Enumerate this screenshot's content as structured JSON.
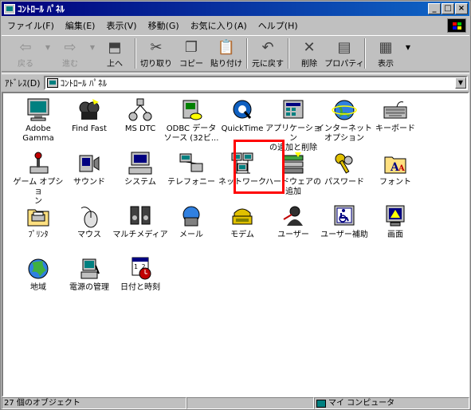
{
  "window": {
    "title": "ｺﾝﾄﾛｰﾙ ﾊﾟﾈﾙ",
    "buttons": {
      "minimize": "_",
      "maximize": "□",
      "close": "×"
    }
  },
  "menu": [
    "ファイル(F)",
    "編集(E)",
    "表示(V)",
    "移動(G)",
    "お気に入り(A)",
    "ヘルプ(H)"
  ],
  "toolbar": {
    "back": "戻る",
    "forward": "進む",
    "up": "上へ",
    "cut": "切り取り",
    "copy": "コピー",
    "paste": "貼り付け",
    "undo": "元に戻す",
    "delete": "削除",
    "properties": "プロパティ",
    "view": "表示"
  },
  "address": {
    "label": "ｱﾄﾞﾚｽ(D)",
    "value": "ｺﾝﾄﾛｰﾙ ﾊﾟﾈﾙ"
  },
  "icons": [
    {
      "label": "Adobe\nGamma",
      "icon": "monitor-icon"
    },
    {
      "label": "Find Fast",
      "icon": "find-fast-icon"
    },
    {
      "label": "MS DTC",
      "icon": "network-nodes-icon"
    },
    {
      "label": "ODBC データ\nソース (32ビ...",
      "icon": "odbc-icon"
    },
    {
      "label": "QuickTime",
      "icon": "quicktime-icon"
    },
    {
      "label": "アプリケーション\nの追加と削除",
      "icon": "add-remove-icon"
    },
    {
      "label": "インターネット\nオプション",
      "icon": "globe-icon"
    },
    {
      "label": "キーボード",
      "icon": "keyboard-icon"
    },
    {
      "label": "ゲーム オプショ\nン",
      "icon": "joystick-icon"
    },
    {
      "label": "サウンド",
      "icon": "speaker-icon"
    },
    {
      "label": "システム",
      "icon": "computer-icon"
    },
    {
      "label": "テレフォニー",
      "icon": "telephony-icon"
    },
    {
      "label": "ネットワーク",
      "icon": "network-icon"
    },
    {
      "label": "ハードウェアの\n追加",
      "icon": "hardware-icon"
    },
    {
      "label": "パスワード",
      "icon": "keys-icon"
    },
    {
      "label": "フォント",
      "icon": "fonts-folder-icon"
    },
    {
      "label": "ﾌﾟﾘﾝﾀ",
      "icon": "printer-folder-icon"
    },
    {
      "label": "マウス",
      "icon": "mouse-icon"
    },
    {
      "label": "マルチメディア",
      "icon": "multimedia-icon"
    },
    {
      "label": "メール",
      "icon": "mail-icon"
    },
    {
      "label": "モデム",
      "icon": "modem-icon"
    },
    {
      "label": "ユーザー",
      "icon": "users-icon"
    },
    {
      "label": "ユーザー補助",
      "icon": "accessibility-icon"
    },
    {
      "label": "画面",
      "icon": "display-icon"
    },
    {
      "label": "地域",
      "icon": "regional-globe-icon"
    },
    {
      "label": "電源の管理",
      "icon": "power-icon"
    },
    {
      "label": "日付と時刻",
      "icon": "calendar-clock-icon"
    }
  ],
  "status": {
    "count": "27 個のオブジェクト",
    "location": "マイ コンピュータ"
  },
  "colors": {
    "title_gradient_start": "#00007b",
    "title_gradient_end": "#0f68c8",
    "highlight": "#ff0000"
  }
}
